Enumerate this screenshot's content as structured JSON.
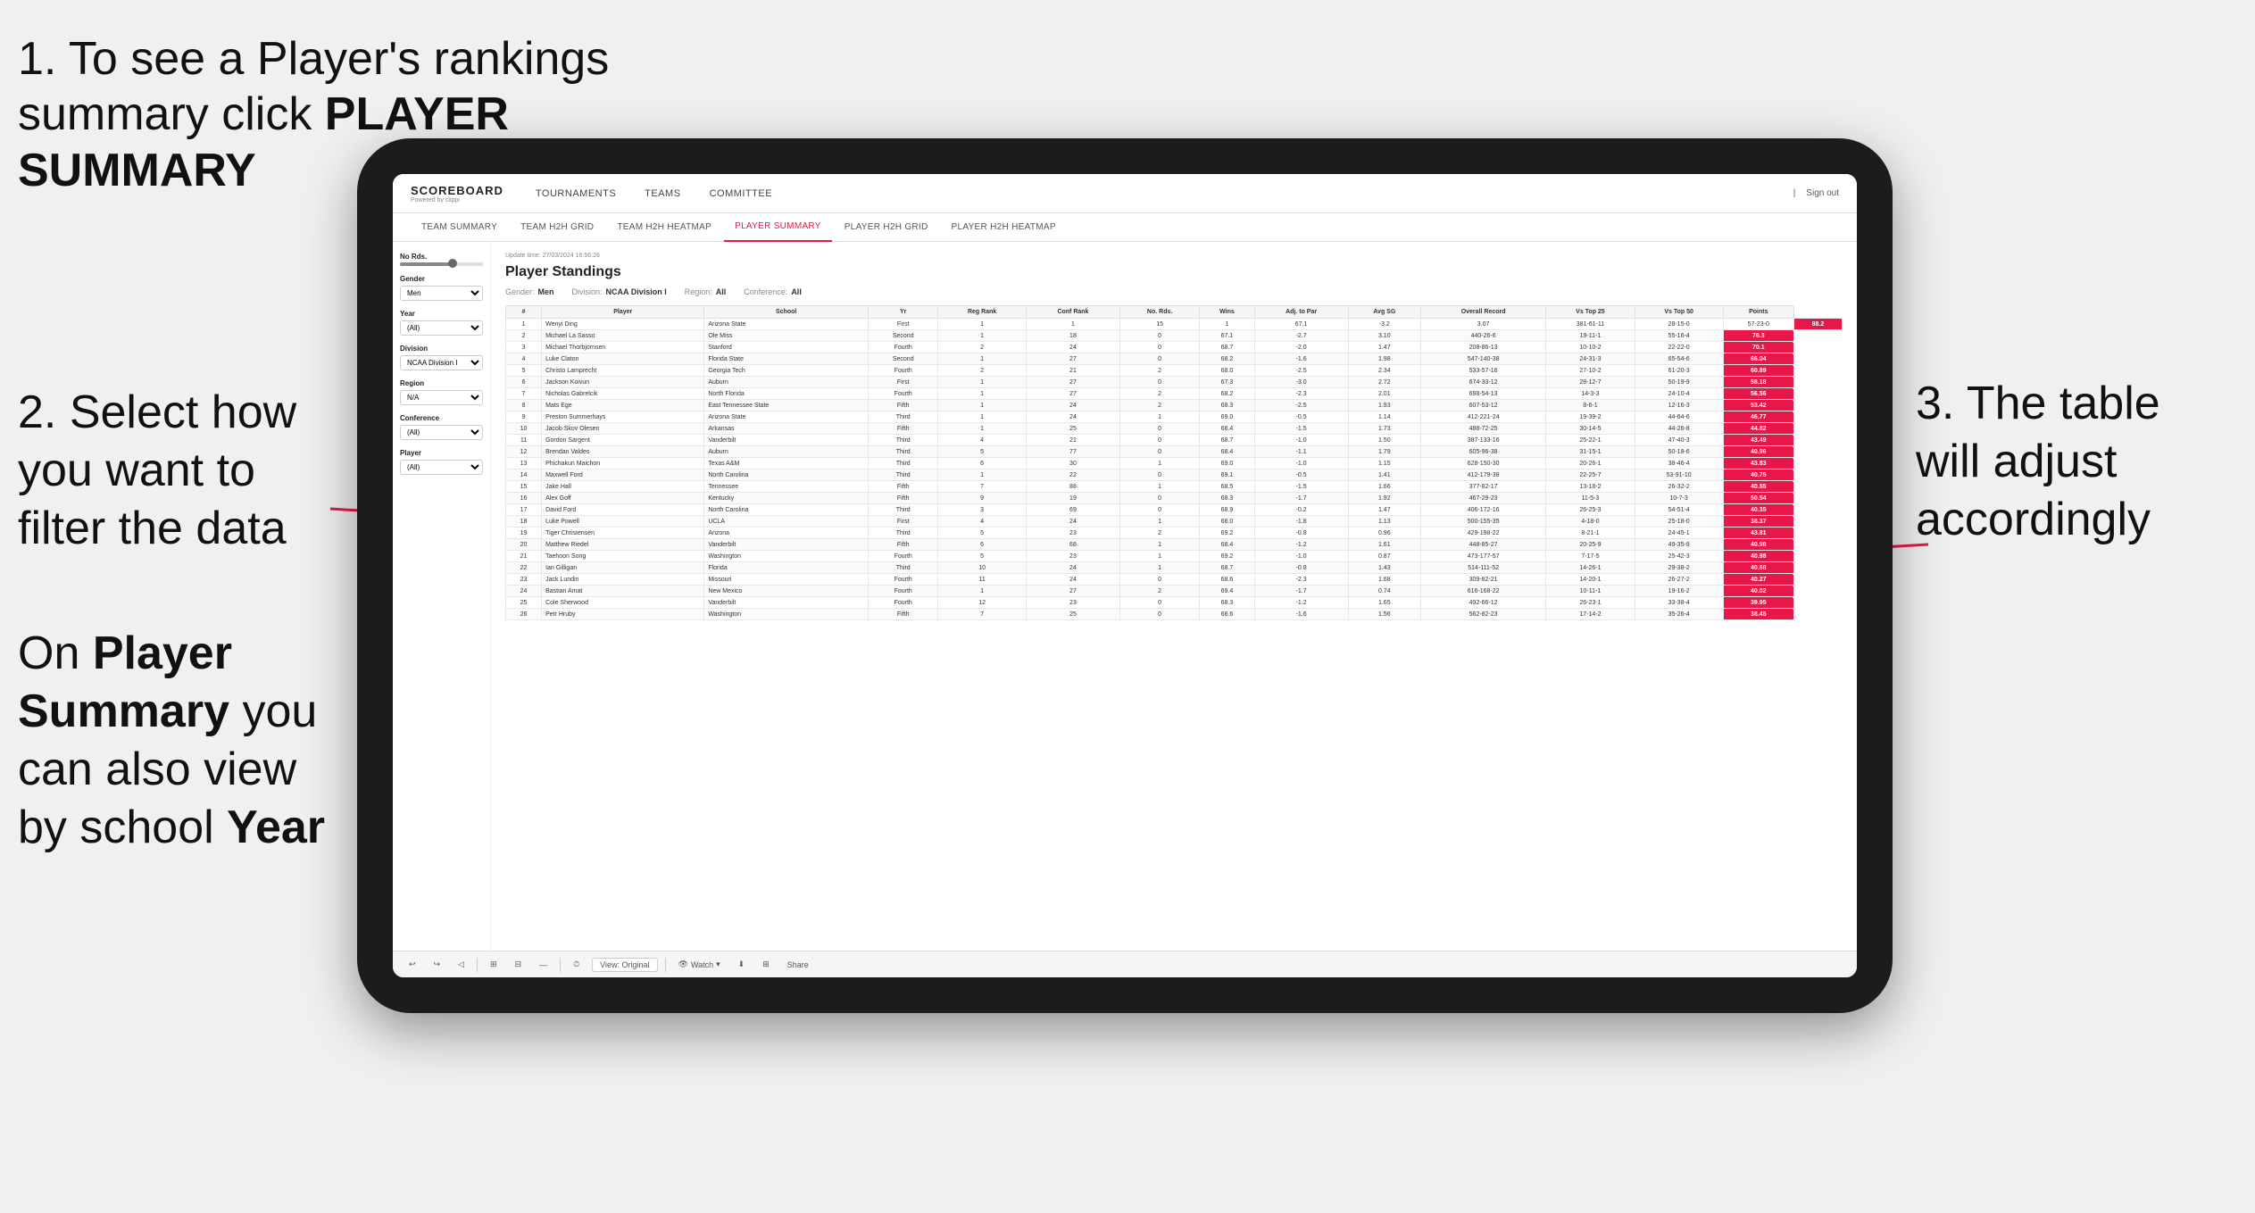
{
  "annotations": {
    "top_left_line1": "1. To see a Player's rankings",
    "top_left_line2": "summary click ",
    "top_left_bold": "PLAYER SUMMARY",
    "mid_left_title": "2. Select how you want to filter the data",
    "bottom_left_line1": "On ",
    "bottom_left_bold1": "Player Summary",
    "bottom_left_line2": " you can also view by school ",
    "bottom_left_bold2": "Year",
    "right_title": "3. The table will adjust accordingly"
  },
  "nav": {
    "logo_title": "SCOREBOARD",
    "logo_sub": "Powered by clippi",
    "items": [
      "TOURNAMENTS",
      "TEAMS",
      "COMMITTEE"
    ],
    "right": [
      "Sign out"
    ]
  },
  "sub_nav": {
    "items": [
      "TEAM SUMMARY",
      "TEAM H2H GRID",
      "TEAM H2H HEATMAP",
      "PLAYER SUMMARY",
      "PLAYER H2H GRID",
      "PLAYER H2H HEATMAP"
    ],
    "active": "PLAYER SUMMARY"
  },
  "filters": {
    "no_rds_label": "No Rds.",
    "gender_label": "Gender",
    "gender_value": "Men",
    "year_label": "Year",
    "year_value": "(All)",
    "division_label": "Division",
    "division_value": "NCAA Division I",
    "region_label": "Region",
    "region_value": "N/A",
    "conference_label": "Conference",
    "conference_value": "(All)",
    "player_label": "Player",
    "player_value": "(All)"
  },
  "table": {
    "update_time": "Update time: 27/03/2024 16:56:26",
    "title": "Player Standings",
    "filter_gender": "Gender: Men",
    "filter_division": "Division: NCAA Division I",
    "filter_region": "Region: All",
    "filter_conference": "Conference: All",
    "columns": [
      "#",
      "Player",
      "School",
      "Yr",
      "Reg Rank",
      "Conf Rank",
      "No. Rds.",
      "Wins",
      "Adj. to Par",
      "Avg SG",
      "Overall Record",
      "Vs Top 25",
      "Vs Top 50",
      "Points"
    ],
    "rows": [
      [
        "1",
        "Wenyi Ding",
        "Arizona State",
        "First",
        "1",
        "1",
        "15",
        "1",
        "67.1",
        "-3.2",
        "3.07",
        "381-61-11",
        "28-15-0",
        "57-23-0",
        "88.2"
      ],
      [
        "2",
        "Michael La Sasso",
        "Ole Miss",
        "Second",
        "1",
        "18",
        "0",
        "67.1",
        "-2.7",
        "3.10",
        "440-26-6",
        "19-11-1",
        "55-16-4",
        "76.3"
      ],
      [
        "3",
        "Michael Thorbjornsen",
        "Stanford",
        "Fourth",
        "2",
        "24",
        "0",
        "68.7",
        "-2.0",
        "1.47",
        "208-86-13",
        "10-10-2",
        "22-22-0",
        "70.1"
      ],
      [
        "4",
        "Luke Claton",
        "Florida State",
        "Second",
        "1",
        "27",
        "0",
        "68.2",
        "-1.6",
        "1.98",
        "547-140-38",
        "24-31-3",
        "65-54-6",
        "66.04"
      ],
      [
        "5",
        "Christo Lamprecht",
        "Georgia Tech",
        "Fourth",
        "2",
        "21",
        "2",
        "68.0",
        "-2.5",
        "2.34",
        "533-57-16",
        "27-10-2",
        "61-20-3",
        "60.89"
      ],
      [
        "6",
        "Jackson Koivun",
        "Auburn",
        "First",
        "1",
        "27",
        "0",
        "67.3",
        "-3.0",
        "2.72",
        "674-33-12",
        "28-12-7",
        "50-19-9",
        "58.18"
      ],
      [
        "7",
        "Nicholas Gabrelcik",
        "North Florida",
        "Fourth",
        "1",
        "27",
        "2",
        "68.2",
        "-2.3",
        "2.01",
        "698-54-13",
        "14-3-3",
        "24-10-4",
        "56.56"
      ],
      [
        "8",
        "Mats Ege",
        "East Tennessee State",
        "Fifth",
        "1",
        "24",
        "2",
        "68.3",
        "-2.5",
        "1.93",
        "607-53-12",
        "8-6-1",
        "12-16-3",
        "53.42"
      ],
      [
        "9",
        "Preston Summerhays",
        "Arizona State",
        "Third",
        "1",
        "24",
        "1",
        "69.0",
        "-0.5",
        "1.14",
        "412-221-24",
        "19-39-2",
        "44-64-6",
        "46.77"
      ],
      [
        "10",
        "Jacob Skov Olesen",
        "Arkansas",
        "Fifth",
        "1",
        "25",
        "0",
        "68.4",
        "-1.5",
        "1.73",
        "488-72-25",
        "30-14-5",
        "44-26-8",
        "44.82"
      ],
      [
        "11",
        "Gordon Sargent",
        "Vanderbilt",
        "Third",
        "4",
        "21",
        "0",
        "68.7",
        "-1.0",
        "1.50",
        "387-133-16",
        "25-22-1",
        "47-40-3",
        "43.49"
      ],
      [
        "12",
        "Brendan Valdes",
        "Auburn",
        "Third",
        "5",
        "77",
        "0",
        "68.4",
        "-1.1",
        "1.79",
        "605-96-38",
        "31-15-1",
        "50-18-6",
        "40.96"
      ],
      [
        "13",
        "Phichakun Maichon",
        "Texas A&M",
        "Third",
        "6",
        "30",
        "1",
        "69.0",
        "-1.0",
        "1.15",
        "628-150-30",
        "20-26-1",
        "38-46-4",
        "43.83"
      ],
      [
        "14",
        "Maxwell Ford",
        "North Carolina",
        "Third",
        "1",
        "22",
        "0",
        "69.1",
        "-0.5",
        "1.41",
        "412-179-38",
        "22-25-7",
        "53-91-10",
        "40.75"
      ],
      [
        "15",
        "Jake Hall",
        "Tennessee",
        "Fifth",
        "7",
        "88",
        "1",
        "68.5",
        "-1.5",
        "1.66",
        "377-82-17",
        "13-18-2",
        "26-32-2",
        "40.55"
      ],
      [
        "16",
        "Alex Goff",
        "Kentucky",
        "Fifth",
        "9",
        "19",
        "0",
        "68.3",
        "-1.7",
        "1.92",
        "467-29-23",
        "11-5-3",
        "10-7-3",
        "50.54"
      ],
      [
        "17",
        "David Ford",
        "North Carolina",
        "Third",
        "3",
        "69",
        "0",
        "68.9",
        "-0.2",
        "1.47",
        "406-172-16",
        "26-25-3",
        "54-51-4",
        "40.35"
      ],
      [
        "18",
        "Luke Powell",
        "UCLA",
        "First",
        "4",
        "24",
        "1",
        "68.0",
        "-1.8",
        "1.13",
        "500-155-35",
        "4-18-0",
        "25-18-0",
        "38.37"
      ],
      [
        "19",
        "Tiger Christensen",
        "Arizona",
        "Third",
        "5",
        "23",
        "2",
        "69.2",
        "-0.8",
        "0.96",
        "429-198-22",
        "8-21-1",
        "24-45-1",
        "43.81"
      ],
      [
        "20",
        "Matthew Riedel",
        "Vanderbilt",
        "Fifth",
        "6",
        "68",
        "1",
        "68.4",
        "-1.2",
        "1.61",
        "448-85-27",
        "20-25-9",
        "49-35-9",
        "40.98"
      ],
      [
        "21",
        "Taehoon Song",
        "Washington",
        "Fourth",
        "5",
        "23",
        "1",
        "69.2",
        "-1.0",
        "0.87",
        "473-177-57",
        "7-17-5",
        "25-42-3",
        "40.98"
      ],
      [
        "22",
        "Ian Gilligan",
        "Florida",
        "Third",
        "10",
        "24",
        "1",
        "68.7",
        "-0.8",
        "1.43",
        "514-111-52",
        "14-26-1",
        "29-38-2",
        "40.68"
      ],
      [
        "23",
        "Jack Lundin",
        "Missouri",
        "Fourth",
        "11",
        "24",
        "0",
        "68.6",
        "-2.3",
        "1.68",
        "309-82-21",
        "14-20-1",
        "26-27-2",
        "40.27"
      ],
      [
        "24",
        "Bastian Amat",
        "New Mexico",
        "Fourth",
        "1",
        "27",
        "2",
        "69.4",
        "-1.7",
        "0.74",
        "616-168-22",
        "10-11-1",
        "19-16-2",
        "40.02"
      ],
      [
        "25",
        "Cole Sherwood",
        "Vanderbilt",
        "Fourth",
        "12",
        "23",
        "0",
        "68.3",
        "-1.2",
        "1.65",
        "492-66-12",
        "26-23-1",
        "33-38-4",
        "39.95"
      ],
      [
        "26",
        "Petr Hruby",
        "Washington",
        "Fifth",
        "7",
        "25",
        "0",
        "68.6",
        "-1.6",
        "1.56",
        "562-82-23",
        "17-14-2",
        "35-26-4",
        "38.45"
      ]
    ]
  },
  "toolbar": {
    "view_label": "View: Original",
    "watch_label": "Watch",
    "share_label": "Share"
  }
}
